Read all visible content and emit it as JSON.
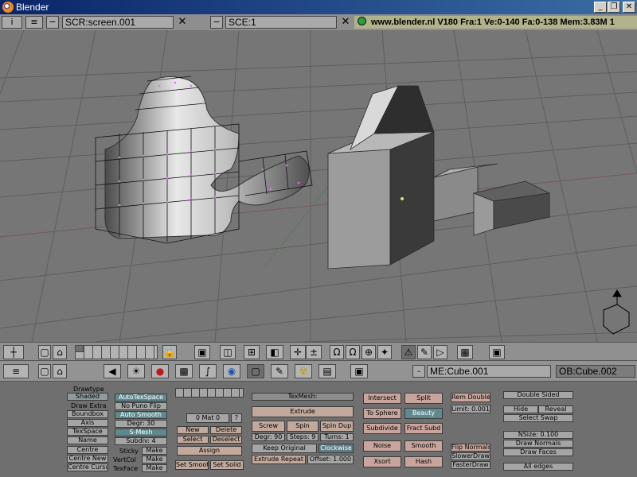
{
  "window": {
    "title": "Blender",
    "minimize": "_",
    "maximize": "❐",
    "close": "✕"
  },
  "info_header": {
    "screen": "SCR:screen.001",
    "scene": "SCE:1",
    "status": "www.blender.nl  V180  Fra:1    Ve:0-140  Fa:0-138   Mem:3.83M  1",
    "x": "✕"
  },
  "view3d_header": {
    "icons": [
      "view-icon",
      "home-icon",
      "layer-buttons",
      "lock-icon",
      "local-view-icon",
      "persp-icon",
      "view-select-icon",
      "draw-type-icon",
      "pivot-icon",
      "manipulator-icons",
      "grab-icon",
      "rotate-icon",
      "scale-icon",
      "render-icon"
    ]
  },
  "buttons_header": {
    "mesh": "ME:Cube.001",
    "object": "OB:Cube.002",
    "dash": "-"
  },
  "mesh_panel": {
    "drawtype_label": "Drawtype",
    "drawtype_value": "Shaded",
    "draw_extra": "Draw Extra",
    "boundbox": "Boundbox",
    "axis": "Axis",
    "texspace": "TexSpace",
    "name": "Name",
    "centre": "Centre",
    "centre_new": "Centre New",
    "centre_cursor": "Centre Cursor",
    "autotexspace": "AutoTexSpace",
    "no_puno_flip": "No Puno Flip",
    "auto_smooth": "Auto Smooth",
    "degr": "Degr: 30",
    "smesh": "S-Mesh",
    "subdiv": "Subdiv: 4",
    "sticky": "Sticky",
    "vertcol": "VertCol",
    "texface": "TexFace",
    "make1": "Make",
    "make2": "Make",
    "make3": "Make"
  },
  "material_panel": {
    "mat": "0 Mat 0",
    "q": "?",
    "new": "New",
    "delete": "Delete",
    "select": "Select",
    "deselect": "Deselect",
    "assign": "Assign",
    "set_smooth": "Set Smooth",
    "set_solid": "Set Solid"
  },
  "edit_panel": {
    "texmesh": "TexMesh:",
    "extrude": "Extrude",
    "screw": "Screw",
    "spin": "Spin",
    "spin_dup": "Spin Dup",
    "degr": "Degr: 90",
    "steps": "Steps: 9",
    "turns": "Turns: 1",
    "keep_original": "Keep Original",
    "clockwise": "Clockwise",
    "extrude_repeat": "Extrude Repeat",
    "offset": "Offset: 1.000"
  },
  "tools_panel": {
    "intersect": "Intersect",
    "split": "Split",
    "to_sphere": "To Sphere",
    "beauty": "Beauty",
    "subdivide": "Subdivide",
    "fract_subd": "Fract Subd",
    "noise": "Noise",
    "smooth": "Smooth",
    "xsort": "Xsort",
    "hash": "Hash"
  },
  "doubles_panel": {
    "rem_doubles": "Rem Doubles",
    "limit": "Limit: 0.001",
    "flip_normals": "Flip Normals",
    "slower_draw": "SlowerDraw",
    "faster_draw": "FasterDraw"
  },
  "display_panel": {
    "double_sided": "Double Sided",
    "hide": "Hide",
    "reveal": "Reveal",
    "select_swap": "Select Swap",
    "nsize": "NSize: 0.100",
    "draw_normals": "Draw Normals",
    "draw_faces": "Draw Faces",
    "all_edges": "All edges"
  },
  "colors": {
    "titlebar": "#0a246a",
    "viewport": "#767676",
    "panel": "#6f6f6f",
    "button": "#a5a5a5",
    "vertex": "#d070e0"
  }
}
